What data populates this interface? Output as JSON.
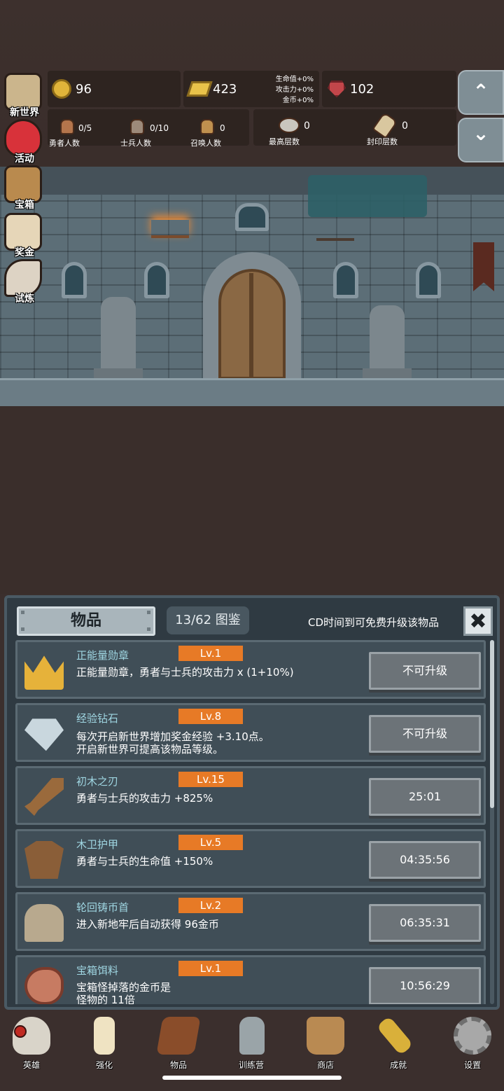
{
  "side_menu": [
    {
      "label": "新世界",
      "icon": "map-icon",
      "color": "#cbb58c"
    },
    {
      "label": "活动",
      "icon": "heart-icon",
      "color": "#d8323a"
    },
    {
      "label": "宝箱",
      "icon": "chest-icon",
      "color": "#b98a4e"
    },
    {
      "label": "奖金",
      "icon": "envelope-icon",
      "color": "#e6d6b8"
    },
    {
      "label": "试炼",
      "icon": "feather-icon",
      "color": "#ddd3c4"
    }
  ],
  "resources": {
    "gold": "96",
    "gold_bar": "423",
    "gem": "102",
    "bonus": {
      "hp": "生命值+0%",
      "attack": "攻击力+0%",
      "coin": "金币+0%"
    }
  },
  "counters": {
    "heroes": {
      "value": "0/5",
      "label": "勇者人数"
    },
    "soldiers": {
      "value": "0/10",
      "label": "士兵人数"
    },
    "summons": {
      "value": "0",
      "label": "召唤人数"
    },
    "max_floor": {
      "value": "0",
      "label": "最高层数"
    },
    "sealed_floor": {
      "value": "0",
      "label": "封印层数"
    }
  },
  "floor_nav": {
    "up": "⌃",
    "down": "⌄"
  },
  "panel": {
    "title": "物品",
    "collection": "13/62 图鉴",
    "cd_note": "CD时间到可免费升级该物品",
    "close": "✖"
  },
  "items": [
    {
      "name": "正能量勋章",
      "level": "Lv.1",
      "desc": "正能量勋章，勇者与士兵的攻击力 x (1+10%)",
      "action": "不可升级",
      "icon": "crown-icon"
    },
    {
      "name": "经验钻石",
      "level": "Lv.8",
      "desc": "每次开启新世界增加奖金经验 +3.10点。\n开启新世界可提高该物品等级。",
      "action": "不可升级",
      "icon": "diamond-icon"
    },
    {
      "name": "初木之刃",
      "level": "Lv.15",
      "desc": "勇者与士兵的攻击力 +825%",
      "action": "25:01",
      "icon": "sword-icon"
    },
    {
      "name": "木卫护甲",
      "level": "Lv.5",
      "desc": "勇者与士兵的生命值 +150%",
      "action": "04:35:56",
      "icon": "armor-icon"
    },
    {
      "name": "轮回铸币首",
      "level": "Lv.2",
      "desc": "进入新地牢后自动获得 96金币",
      "action": "06:35:31",
      "icon": "helmet-icon"
    },
    {
      "name": "宝箱饵料",
      "level": "Lv.1",
      "desc": "宝箱怪掉落的金币是\n怪物的 11倍",
      "action": "10:56:29",
      "icon": "meat-icon"
    }
  ],
  "bottom_nav": [
    {
      "label": "英雄",
      "icon": "skull-icon",
      "color": "#d9d4c9"
    },
    {
      "label": "强化",
      "icon": "candle-icon",
      "color": "#efe3c2"
    },
    {
      "label": "物品",
      "icon": "book-icon",
      "color": "#8a4d2a"
    },
    {
      "label": "训练营",
      "icon": "lantern-icon",
      "color": "#9aa4a8"
    },
    {
      "label": "商店",
      "icon": "mug-icon",
      "color": "#b98a52"
    },
    {
      "label": "成就",
      "icon": "key-icon",
      "color": "#d9b03a"
    },
    {
      "label": "设置",
      "icon": "gear-icon",
      "color": "#a8a8a8"
    }
  ]
}
